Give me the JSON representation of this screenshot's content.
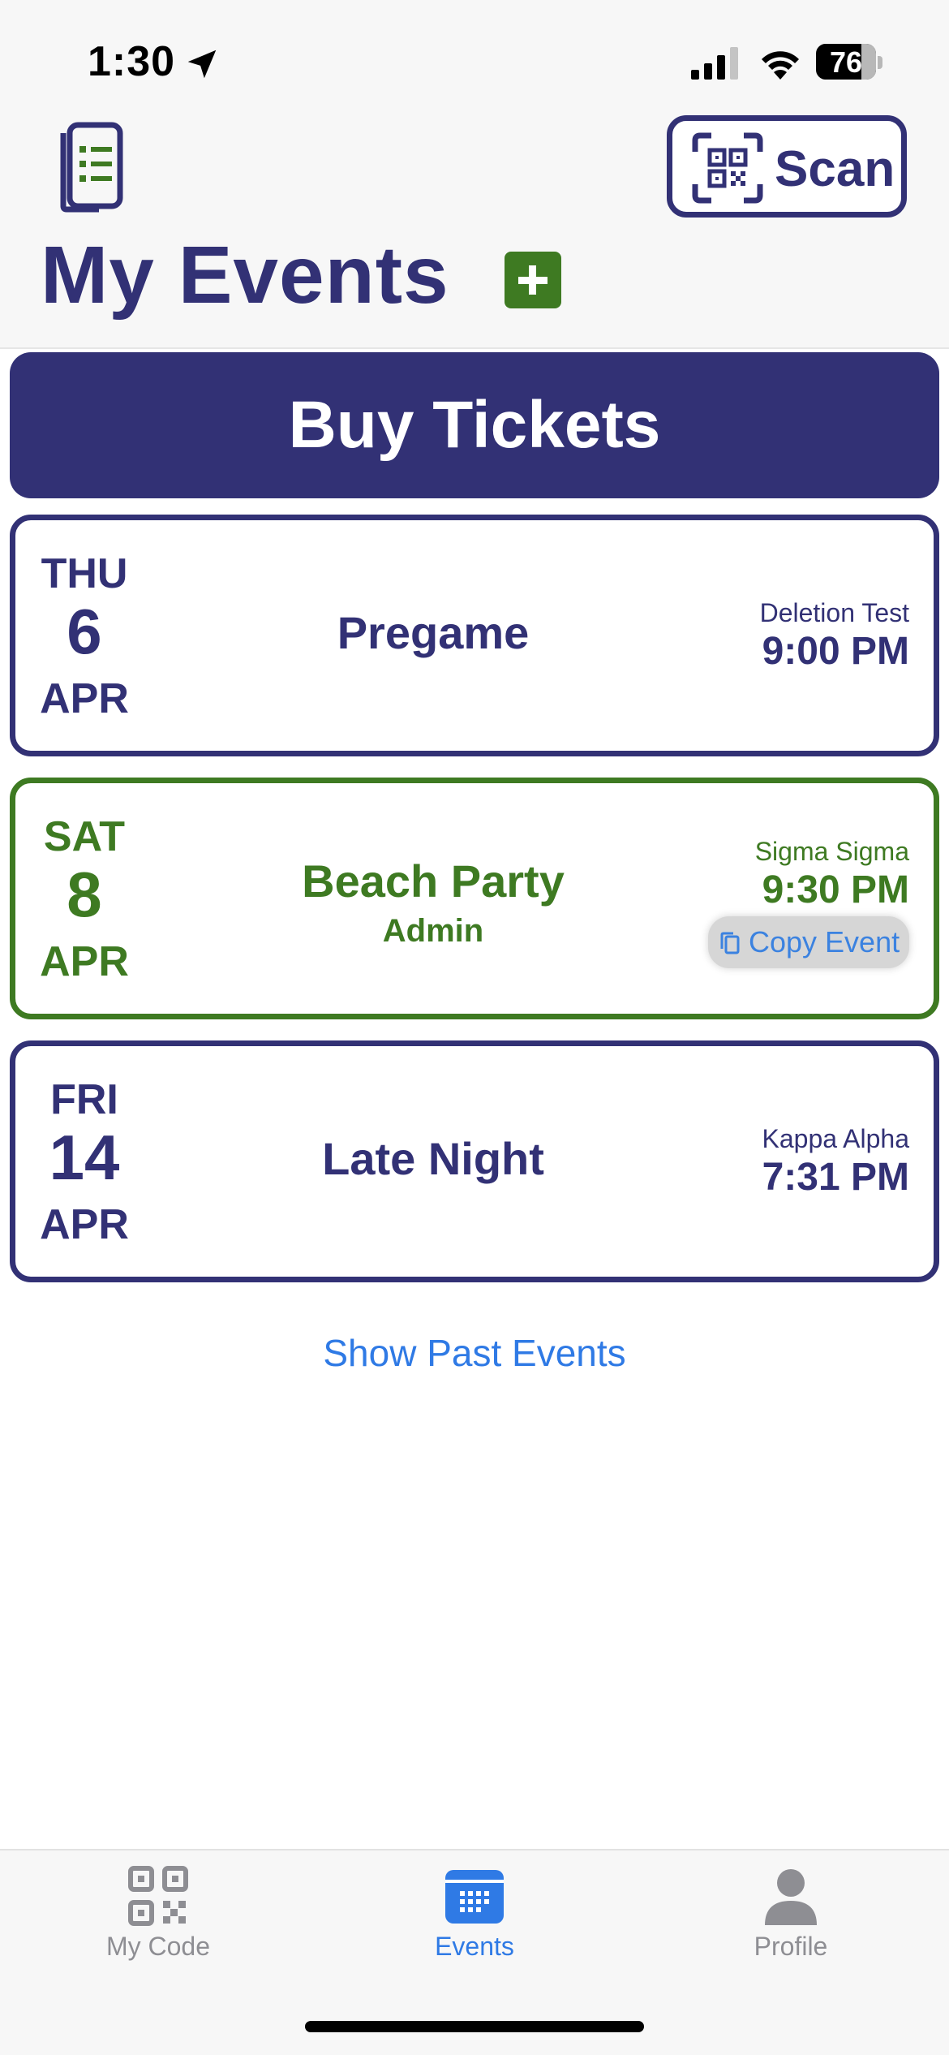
{
  "status_bar": {
    "time": "1:30",
    "battery": "76"
  },
  "header": {
    "scan_label": "Scan",
    "title": "My Events"
  },
  "buy_tickets_label": "Buy Tickets",
  "events": [
    {
      "day_of_week": "THU",
      "day": "6",
      "month": "APR",
      "name": "Pregame",
      "organization": "Deletion Test",
      "time": "9:00 PM"
    },
    {
      "day_of_week": "SAT",
      "day": "8",
      "month": "APR",
      "name": "Beach Party",
      "role": "Admin",
      "organization": "Sigma Sigma",
      "time": "9:30 PM",
      "copy_label": "Copy Event"
    },
    {
      "day_of_week": "FRI",
      "day": "14",
      "month": "APR",
      "name": "Late Night",
      "organization": "Kappa Alpha",
      "time": "7:31 PM"
    }
  ],
  "show_past_label": "Show Past Events",
  "tabs": [
    {
      "label": "My Code",
      "icon": "qr-code-icon"
    },
    {
      "label": "Events",
      "icon": "calendar-icon",
      "active": true
    },
    {
      "label": "Profile",
      "icon": "person-icon"
    }
  ],
  "colors": {
    "primary": "#323175",
    "accent_green": "#3e7a22",
    "link_blue": "#2f7ae5"
  }
}
